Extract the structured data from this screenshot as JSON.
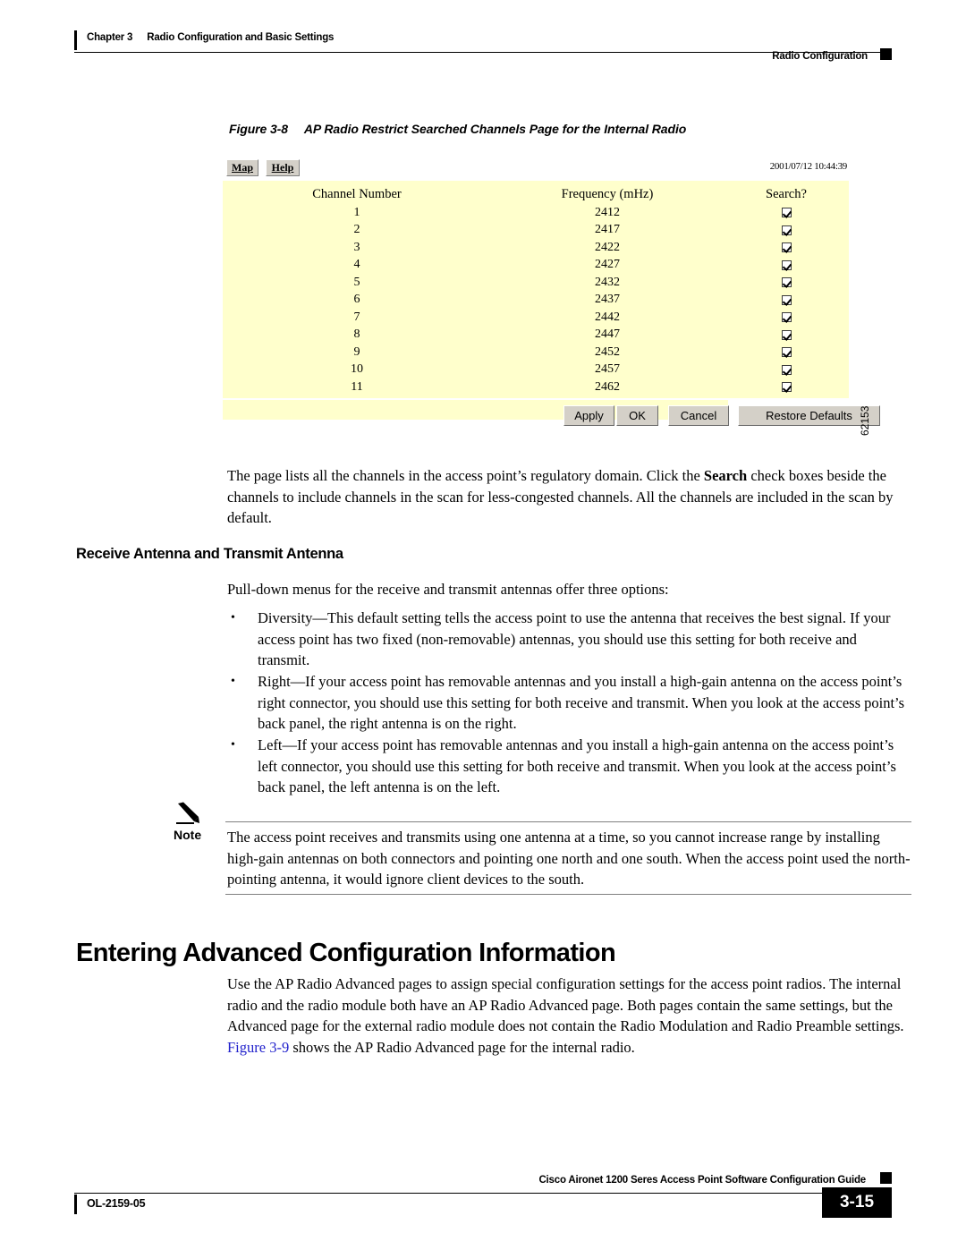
{
  "header": {
    "chapter": "Chapter 3",
    "chapter_title": "Radio Configuration and Basic Settings",
    "section": "Radio Configuration"
  },
  "figure": {
    "number": "Figure 3-8",
    "title": "AP Radio Restrict Searched Channels Page for the Internal Radio",
    "figure_id": "62153"
  },
  "screenshot": {
    "toolbar": {
      "map_button": "Map",
      "help_button": "Help",
      "timestamp": "2001/07/12 10:44:39"
    },
    "table": {
      "headers": [
        "Channel Number",
        "Frequency (mHz)",
        "Search?"
      ],
      "rows": [
        {
          "channel": "1",
          "frequency": "2412",
          "search": true
        },
        {
          "channel": "2",
          "frequency": "2417",
          "search": true
        },
        {
          "channel": "3",
          "frequency": "2422",
          "search": true
        },
        {
          "channel": "4",
          "frequency": "2427",
          "search": true
        },
        {
          "channel": "5",
          "frequency": "2432",
          "search": true
        },
        {
          "channel": "6",
          "frequency": "2437",
          "search": true
        },
        {
          "channel": "7",
          "frequency": "2442",
          "search": true
        },
        {
          "channel": "8",
          "frequency": "2447",
          "search": true
        },
        {
          "channel": "9",
          "frequency": "2452",
          "search": true
        },
        {
          "channel": "10",
          "frequency": "2457",
          "search": true
        },
        {
          "channel": "11",
          "frequency": "2462",
          "search": true
        }
      ]
    },
    "buttons": {
      "apply": "Apply",
      "ok": "OK",
      "cancel": "Cancel",
      "restore_defaults": "Restore Defaults"
    },
    "panel_color": "#ffffcc"
  },
  "body": {
    "intro_part1": "The page lists all the channels in the access point’s regulatory domain. Click the ",
    "intro_bold": "Search",
    "intro_part2": " check boxes beside the channels to include channels in the scan for less-congested channels. All the channels are included in the scan by default.",
    "subheading": "Receive Antenna and Transmit Antenna",
    "pulldown_intro": "Pull-down menus for the receive and transmit antennas offer three options:",
    "bullets": [
      "Diversity—This default setting tells the access point to use the antenna that receives the best signal. If your access point has two fixed (non-removable) antennas, you should use this setting for both receive and transmit.",
      "Right—If your access point has removable antennas and you install a high-gain antenna on the access point’s right connector, you should use this setting for both receive and transmit. When you look at the access point’s back panel, the right antenna is on the right.",
      "Left—If your access point has removable antennas and you install a high-gain antenna on the access point’s left connector, you should use this setting for both receive and transmit. When you look at the access point’s back panel, the left antenna is on the left."
    ],
    "bullet_glyph": "•",
    "note": {
      "label": "Note",
      "text": "The access point receives and transmits using one antenna at a time, so you cannot increase range by installing high-gain antennas on both connectors and pointing one north and one south. When the access point used the north-pointing antenna, it would ignore client devices to the south."
    },
    "main_heading": "Entering Advanced Configuration Information",
    "advanced_part1": "Use the AP Radio Advanced pages to assign special configuration settings for the access point radios. The internal radio and the radio module both have an AP Radio Advanced page. Both pages contain the same settings, but the Advanced page for the external radio module does not contain the Radio Modulation and Radio Preamble settings. ",
    "advanced_link": "Figure 3-9",
    "advanced_part2": " shows the AP Radio Advanced page for the internal radio."
  },
  "footer": {
    "guide_title": "Cisco Aironet 1200 Seres Access Point Software Configuration Guide",
    "doc_id": "OL-2159-05",
    "page_number": "3-15"
  }
}
